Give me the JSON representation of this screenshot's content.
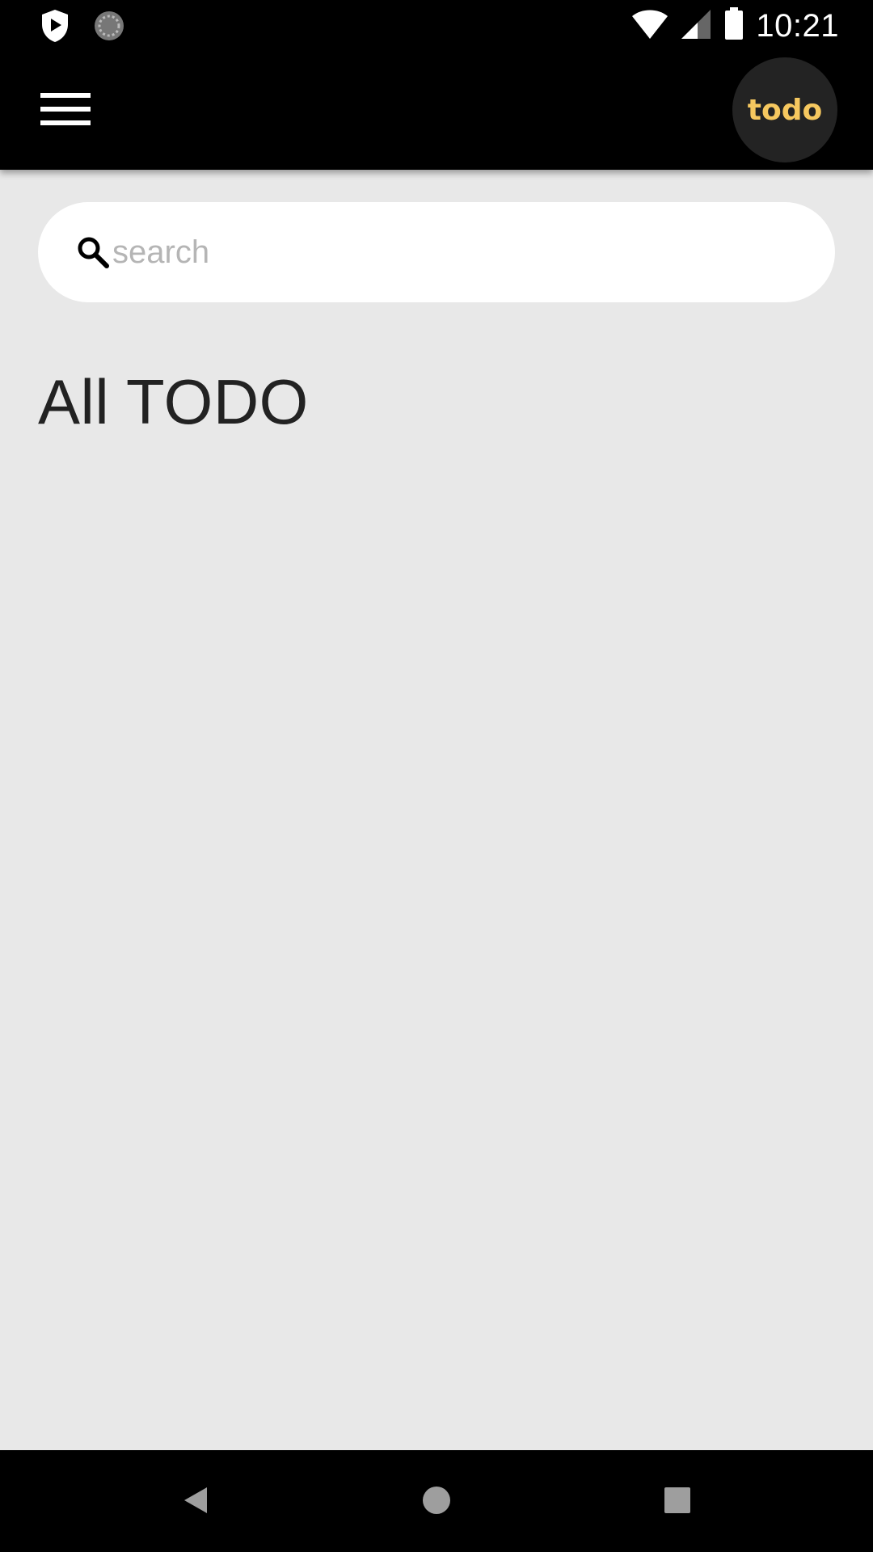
{
  "status_bar": {
    "time": "10:21",
    "icons": [
      "play-shield-icon",
      "sync-icon",
      "wifi-icon",
      "signal-icon",
      "battery-icon"
    ]
  },
  "app_bar": {
    "menu_icon": "hamburger-menu-icon",
    "logo_text": "todo",
    "logo_color": "#f6c85f"
  },
  "search": {
    "placeholder": "search",
    "value": "",
    "icon": "search-icon"
  },
  "main": {
    "title": "All TODO",
    "items": []
  },
  "nav_bar": {
    "buttons": [
      "back-icon",
      "home-icon",
      "recents-icon"
    ]
  },
  "colors": {
    "background": "#e8e8e8",
    "bars": "#000000",
    "accent": "#f6c85f"
  }
}
